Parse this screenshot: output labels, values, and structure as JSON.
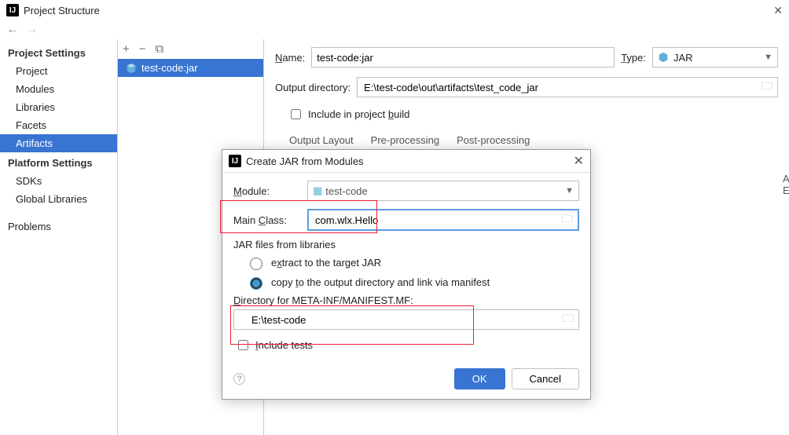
{
  "window": {
    "title": "Project Structure"
  },
  "sidebar": {
    "sections": [
      {
        "title": "Project Settings",
        "items": [
          "Project",
          "Modules",
          "Libraries",
          "Facets",
          "Artifacts"
        ]
      },
      {
        "title": "Platform Settings",
        "items": [
          "SDKs",
          "Global Libraries"
        ]
      },
      {
        "title_empty": null,
        "items": [
          "Problems"
        ]
      }
    ],
    "selected": "Artifacts"
  },
  "artifacts_list": {
    "items": [
      "test-code:jar"
    ],
    "selected": 0
  },
  "form": {
    "name_label": "Name:",
    "name_value": "test-code:jar",
    "type_label": "Type:",
    "type_value": "JAR",
    "output_label": "Output directory:",
    "output_value": "E:\\test-code\\out\\artifacts\\test_code_jar",
    "include_label": "Include in project build",
    "tabs": [
      "Output Layout",
      "Pre-processing",
      "Post-processing"
    ],
    "active_tab": 0,
    "available_label": "Available Elements"
  },
  "modal": {
    "title": "Create JAR from Modules",
    "module_label": "Module:",
    "module_value": "test-code",
    "main_class_label": "Main Class:",
    "main_class_value": "com.wlx.Hello",
    "libs_header": "JAR files from libraries",
    "radio_extract": "extract to the target JAR",
    "radio_copy": "copy to the output directory and link via manifest",
    "radio_selected": "copy",
    "dir_label": "Directory for META-INF/MANIFEST.MF:",
    "dir_value": "E:\\test-code",
    "include_tests": "Include tests",
    "ok": "OK",
    "cancel": "Cancel"
  }
}
